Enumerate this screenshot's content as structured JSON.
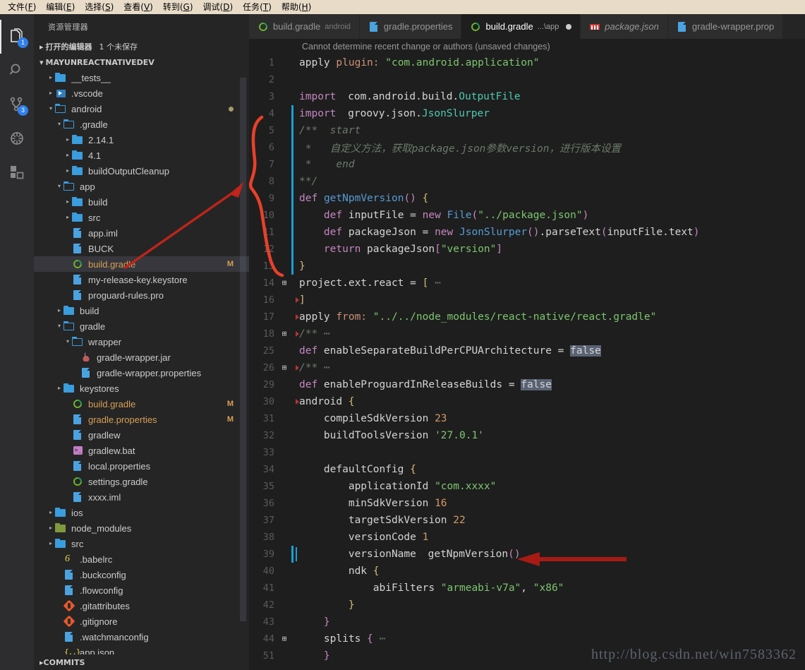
{
  "menubar": {
    "items": [
      {
        "label": "文件(F)",
        "key": "F"
      },
      {
        "label": "编辑(E)",
        "key": "E"
      },
      {
        "label": "选择(S)",
        "key": "S"
      },
      {
        "label": "查看(V)",
        "key": "V"
      },
      {
        "label": "转到(G)",
        "key": "G"
      },
      {
        "label": "调试(D)",
        "key": "D"
      },
      {
        "label": "任务(T)",
        "key": "T"
      },
      {
        "label": "帮助(H)",
        "key": "H"
      }
    ]
  },
  "activitybar": {
    "items": [
      {
        "name": "explorer",
        "icon": "files-icon",
        "badge": "1",
        "active": true
      },
      {
        "name": "search",
        "icon": "search-icon",
        "badge": "",
        "active": false
      },
      {
        "name": "source-control",
        "icon": "source-control-icon",
        "badge": "3",
        "active": false
      },
      {
        "name": "debug",
        "icon": "debug-icon",
        "badge": "",
        "active": false
      },
      {
        "name": "extensions",
        "icon": "extensions-icon",
        "badge": "",
        "active": false
      }
    ]
  },
  "sidebar": {
    "title": "资源管理器",
    "open_editors": {
      "label": "打开的编辑器",
      "detail": "1 个未保存"
    },
    "project": "MAYUNREACTNATIVEDEV",
    "bottom_section": "COMMITS",
    "tree": [
      {
        "label": "__tests__",
        "indent": 1,
        "twisty": "collapsed",
        "icon": "folder-closed",
        "kind": "folder"
      },
      {
        "label": ".vscode",
        "indent": 1,
        "twisty": "collapsed",
        "icon": "vscode",
        "kind": "folder"
      },
      {
        "label": "android",
        "indent": 1,
        "twisty": "expanded",
        "icon": "folder-open",
        "kind": "folder",
        "dot": true
      },
      {
        "label": ".gradle",
        "indent": 2,
        "twisty": "expanded",
        "icon": "folder-open",
        "kind": "folder"
      },
      {
        "label": "2.14.1",
        "indent": 3,
        "twisty": "collapsed",
        "icon": "folder-closed",
        "kind": "folder"
      },
      {
        "label": "4.1",
        "indent": 3,
        "twisty": "collapsed",
        "icon": "folder-closed",
        "kind": "folder"
      },
      {
        "label": "buildOutputCleanup",
        "indent": 3,
        "twisty": "collapsed",
        "icon": "folder-closed",
        "kind": "folder"
      },
      {
        "label": "app",
        "indent": 2,
        "twisty": "expanded",
        "icon": "folder-open",
        "kind": "folder"
      },
      {
        "label": "build",
        "indent": 3,
        "twisty": "collapsed",
        "icon": "folder-closed",
        "kind": "folder"
      },
      {
        "label": "src",
        "indent": 3,
        "twisty": "collapsed",
        "icon": "folder-closed",
        "kind": "folder"
      },
      {
        "label": "app.iml",
        "indent": 3,
        "twisty": "none",
        "icon": "doc",
        "kind": "file"
      },
      {
        "label": "BUCK",
        "indent": 3,
        "twisty": "none",
        "icon": "doc",
        "kind": "file"
      },
      {
        "label": "build.gradle",
        "indent": 3,
        "twisty": "none",
        "icon": "gradle",
        "kind": "file",
        "selected": true,
        "modified": "M"
      },
      {
        "label": "my-release-key.keystore",
        "indent": 3,
        "twisty": "none",
        "icon": "doc",
        "kind": "file"
      },
      {
        "label": "proguard-rules.pro",
        "indent": 3,
        "twisty": "none",
        "icon": "doc",
        "kind": "file"
      },
      {
        "label": "build",
        "indent": 2,
        "twisty": "collapsed",
        "icon": "folder-closed",
        "kind": "folder"
      },
      {
        "label": "gradle",
        "indent": 2,
        "twisty": "expanded",
        "icon": "folder-open",
        "kind": "folder"
      },
      {
        "label": "wrapper",
        "indent": 3,
        "twisty": "expanded",
        "icon": "folder-open",
        "kind": "folder"
      },
      {
        "label": "gradle-wrapper.jar",
        "indent": 4,
        "twisty": "none",
        "icon": "java",
        "kind": "file"
      },
      {
        "label": "gradle-wrapper.properties",
        "indent": 4,
        "twisty": "none",
        "icon": "doc",
        "kind": "file"
      },
      {
        "label": "keystores",
        "indent": 2,
        "twisty": "collapsed",
        "icon": "folder-closed",
        "kind": "folder"
      },
      {
        "label": "build.gradle",
        "indent": 3,
        "twisty": "none",
        "icon": "gradle",
        "kind": "file",
        "modified": "M"
      },
      {
        "label": "gradle.properties",
        "indent": 3,
        "twisty": "none",
        "icon": "doc",
        "kind": "file",
        "modified": "M"
      },
      {
        "label": "gradlew",
        "indent": 3,
        "twisty": "none",
        "icon": "doc",
        "kind": "file"
      },
      {
        "label": "gradlew.bat",
        "indent": 3,
        "twisty": "none",
        "icon": "bat",
        "kind": "file"
      },
      {
        "label": "local.properties",
        "indent": 3,
        "twisty": "none",
        "icon": "doc",
        "kind": "file"
      },
      {
        "label": "settings.gradle",
        "indent": 3,
        "twisty": "none",
        "icon": "gradle",
        "kind": "file"
      },
      {
        "label": "xxxx.iml",
        "indent": 3,
        "twisty": "none",
        "icon": "doc",
        "kind": "file"
      },
      {
        "label": "ios",
        "indent": 1,
        "twisty": "collapsed",
        "icon": "folder-closed",
        "kind": "folder"
      },
      {
        "label": "node_modules",
        "indent": 1,
        "twisty": "collapsed",
        "icon": "folder-green",
        "kind": "folder"
      },
      {
        "label": "src",
        "indent": 1,
        "twisty": "collapsed",
        "icon": "folder-closed",
        "kind": "folder"
      },
      {
        "label": ".babelrc",
        "indent": 2,
        "twisty": "none",
        "icon": "babel",
        "kind": "file"
      },
      {
        "label": ".buckconfig",
        "indent": 2,
        "twisty": "none",
        "icon": "doc",
        "kind": "file"
      },
      {
        "label": ".flowconfig",
        "indent": 2,
        "twisty": "none",
        "icon": "doc",
        "kind": "file"
      },
      {
        "label": ".gitattributes",
        "indent": 2,
        "twisty": "none",
        "icon": "git",
        "kind": "file"
      },
      {
        "label": ".gitignore",
        "indent": 2,
        "twisty": "none",
        "icon": "git",
        "kind": "file"
      },
      {
        "label": ".watchmanconfig",
        "indent": 2,
        "twisty": "none",
        "icon": "doc",
        "kind": "file"
      },
      {
        "label": "app.json",
        "indent": 2,
        "twisty": "none",
        "icon": "json",
        "kind": "file"
      }
    ]
  },
  "tabs": [
    {
      "name": "build.gradle",
      "desc": "android",
      "icon": "gradle",
      "active": false,
      "dirty": false,
      "preview": false
    },
    {
      "name": "gradle.properties",
      "desc": "",
      "icon": "doc",
      "active": false,
      "dirty": false,
      "preview": false
    },
    {
      "name": "build.gradle",
      "desc": "...\\app",
      "icon": "gradle",
      "active": true,
      "dirty": true,
      "preview": false
    },
    {
      "name": "package.json",
      "desc": "",
      "icon": "npm",
      "active": false,
      "dirty": false,
      "preview": true
    },
    {
      "name": "gradle-wrapper.prop",
      "desc": "",
      "icon": "doc",
      "active": false,
      "dirty": false,
      "preview": false
    }
  ],
  "editor": {
    "codelens": "Cannot determine recent change or authors (unsaved changes)",
    "watermark": "http://blog.csdn.net/win7583362",
    "lines": [
      {
        "n": "1",
        "fold": "",
        "edit": false,
        "diff": false,
        "html": "<span class=\"txt\">apply <span class=\"kw\">plugin:</span> <span class=\"str\">\"com.android.application\"</span></span>"
      },
      {
        "n": "2",
        "fold": "",
        "edit": false,
        "diff": false,
        "html": "<span class=\"txt\"></span>"
      },
      {
        "n": "3",
        "fold": "",
        "edit": false,
        "diff": false,
        "html": "<span class=\"txt\"><span class=\"imp\">import</span> <span class=\"txt\">com.android.build.<span class=\"cls\">OutputFile</span></span></span>"
      },
      {
        "n": "4",
        "fold": "",
        "edit": true,
        "diff": false,
        "html": "<span class=\"txt\"><span class=\"imp\">import</span> <span class=\"txt\">groovy.json.<span class=\"cls\">JsonSlurper</span></span></span>"
      },
      {
        "n": "5",
        "fold": "",
        "edit": true,
        "diff": false,
        "html": "<span class=\"txt\"><span class=\"cm\">/**  start</span></span>"
      },
      {
        "n": "6",
        "fold": "",
        "edit": true,
        "diff": false,
        "html": "<span class=\"txt\"><span class=\"cm\"> *   自定义方法，获取package.json参数version，进行版本设置</span></span>"
      },
      {
        "n": "7",
        "fold": "",
        "edit": true,
        "diff": false,
        "html": "<span class=\"txt\"><span class=\"cm\"> *    end</span></span>"
      },
      {
        "n": "8",
        "fold": "",
        "edit": true,
        "diff": false,
        "html": "<span class=\"txt\"><span class=\"cm\">**/</span></span>"
      },
      {
        "n": "9",
        "fold": "",
        "edit": true,
        "diff": false,
        "html": "<span class=\"txt\"><span class=\"k\">def</span> <span class=\"pn\">getNpmVersion</span><span class=\"brp\">()</span> <span class=\"br\">{</span></span>"
      },
      {
        "n": "10",
        "fold": "",
        "edit": true,
        "diff": false,
        "html": "<span class=\"txt\">    <span class=\"k\">def</span> inputFile = <span class=\"k\">new</span> <span class=\"pn\">File</span><span class=\"brp\">(</span><span class=\"str\">\"../package.json\"</span><span class=\"brp\">)</span></span>"
      },
      {
        "n": "11",
        "fold": "",
        "edit": true,
        "diff": false,
        "html": "<span class=\"txt\">    <span class=\"k\">def</span> packageJson = <span class=\"k\">new</span> <span class=\"pn\">JsonSlurper</span><span class=\"brp\">()</span>.parseText<span class=\"brp\">(</span>inputFile.text<span class=\"brp\">)</span></span>"
      },
      {
        "n": "12",
        "fold": "",
        "edit": true,
        "diff": false,
        "html": "<span class=\"txt\">    <span class=\"k\">return</span> packageJson<span class=\"brp\">[</span><span class=\"str\">\"version\"</span><span class=\"brp\">]</span></span>"
      },
      {
        "n": "13",
        "fold": "",
        "edit": true,
        "diff": false,
        "html": "<span class=\"txt\"><span class=\"br\">}</span></span>"
      },
      {
        "n": "14",
        "fold": "+",
        "edit": false,
        "diff": false,
        "html": "<span class=\"txt\">project.ext.react = <span class=\"br\">[</span> <span class=\"cm\">⋯</span></span>"
      },
      {
        "n": "16",
        "fold": "",
        "edit": false,
        "diff": true,
        "html": "<span class=\"txt\"><span class=\"br\">]</span></span>"
      },
      {
        "n": "17",
        "fold": "",
        "edit": false,
        "diff": true,
        "html": "<span class=\"txt\">apply <span class=\"kw\">from:</span> <span class=\"str\">\"../../node_modules/react-native/react.gradle\"</span></span>"
      },
      {
        "n": "18",
        "fold": "+",
        "edit": false,
        "diff": true,
        "html": "<span class=\"txt\"><span class=\"cm\">/** ⋯</span></span>"
      },
      {
        "n": "25",
        "fold": "",
        "edit": false,
        "diff": false,
        "html": "<span class=\"txt\"><span class=\"k\">def</span> enableSeparateBuildPerCPUArchitecture = <span class=\"hl\">false</span></span>"
      },
      {
        "n": "26",
        "fold": "+",
        "edit": false,
        "diff": true,
        "html": "<span class=\"txt\"><span class=\"cm\">/** ⋯</span></span>"
      },
      {
        "n": "29",
        "fold": "",
        "edit": false,
        "diff": false,
        "html": "<span class=\"txt\"><span class=\"k\">def</span> enableProguardInReleaseBuilds = <span class=\"hl\">false</span></span>"
      },
      {
        "n": "30",
        "fold": "",
        "edit": false,
        "diff": true,
        "html": "<span class=\"txt\">android <span class=\"br\">{</span></span>"
      },
      {
        "n": "31",
        "fold": "",
        "edit": false,
        "diff": false,
        "html": "<span class=\"txt\">    compileSdkVersion <span class=\"num\">23</span></span>"
      },
      {
        "n": "32",
        "fold": "",
        "edit": false,
        "diff": false,
        "html": "<span class=\"txt\">    buildToolsVersion <span class=\"str\">'27.0.1'</span></span>"
      },
      {
        "n": "33",
        "fold": "",
        "edit": false,
        "diff": false,
        "html": "<span class=\"txt\"></span>"
      },
      {
        "n": "34",
        "fold": "",
        "edit": false,
        "diff": false,
        "html": "<span class=\"txt\">    defaultConfig <span class=\"br\">{</span></span>"
      },
      {
        "n": "35",
        "fold": "",
        "edit": false,
        "diff": false,
        "html": "<span class=\"txt\">        applicationId <span class=\"str\">\"com.xxxx\"</span></span>"
      },
      {
        "n": "36",
        "fold": "",
        "edit": false,
        "diff": false,
        "html": "<span class=\"txt\">        minSdkVersion <span class=\"num\">16</span></span>"
      },
      {
        "n": "37",
        "fold": "",
        "edit": false,
        "diff": false,
        "html": "<span class=\"txt\">        targetSdkVersion <span class=\"num\">22</span></span>"
      },
      {
        "n": "38",
        "fold": "",
        "edit": false,
        "diff": false,
        "html": "<span class=\"txt\">        versionCode <span class=\"num\">1</span></span>"
      },
      {
        "n": "39",
        "fold": "",
        "edit": true,
        "diff": false,
        "cursor": true,
        "html": "<span class=\"txt\">        versionName <span class=\"txt\">getNpmVersion</span><span class=\"brp\">()</span></span>"
      },
      {
        "n": "40",
        "fold": "",
        "edit": false,
        "diff": false,
        "html": "<span class=\"txt\">        ndk <span class=\"br\">{</span></span>"
      },
      {
        "n": "41",
        "fold": "",
        "edit": false,
        "diff": false,
        "html": "<span class=\"txt\">            abiFilters <span class=\"str\">\"armeabi-v7a\"</span>, <span class=\"str\">\"x86\"</span></span>"
      },
      {
        "n": "42",
        "fold": "",
        "edit": false,
        "diff": false,
        "html": "<span class=\"txt\">        <span class=\"br\">}</span></span>"
      },
      {
        "n": "43",
        "fold": "",
        "edit": false,
        "diff": false,
        "html": "<span class=\"txt\">    <span class=\"brp\">}</span></span>"
      },
      {
        "n": "44",
        "fold": "+",
        "edit": false,
        "diff": false,
        "html": "<span class=\"txt\">    splits <span class=\"brp\">{</span> <span class=\"cm\">⋯</span></span>"
      },
      {
        "n": "51",
        "fold": "",
        "edit": false,
        "diff": false,
        "html": "<span class=\"txt\">    <span class=\"brp\">}</span></span>"
      }
    ]
  },
  "annotations": {
    "bracket_color": "#e8402a",
    "arrow_color": "#a81a14",
    "bracket_label": "red-hand-drawn-bracket-lines-4-13",
    "arrow1_label": "red-arrow-to-build-gradle",
    "arrow2_label": "red-arrow-to-versionName"
  }
}
